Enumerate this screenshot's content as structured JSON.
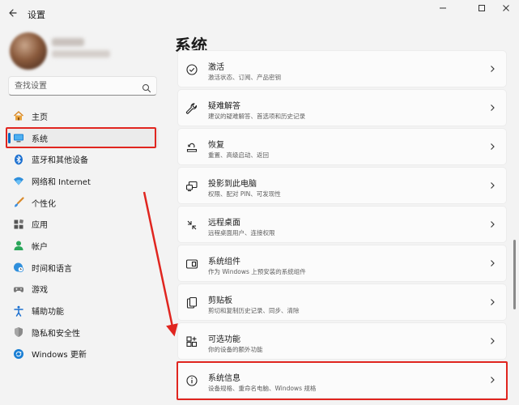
{
  "window": {
    "title": "设置",
    "back_icon": "back-arrow-icon",
    "controls": [
      "minimize-icon",
      "maximize-icon",
      "close-icon"
    ]
  },
  "profile": {
    "avatar": "blurred-avatar"
  },
  "search": {
    "placeholder": "查找设置",
    "icon": "search-icon"
  },
  "sidebar": {
    "items": [
      {
        "label": "主页",
        "icon": "home-icon",
        "selected": false
      },
      {
        "label": "系统",
        "icon": "display-icon",
        "selected": true
      },
      {
        "label": "蓝牙和其他设备",
        "icon": "bluetooth-icon",
        "selected": false
      },
      {
        "label": "网络和 Internet",
        "icon": "wifi-icon",
        "selected": false
      },
      {
        "label": "个性化",
        "icon": "brush-icon",
        "selected": false
      },
      {
        "label": "应用",
        "icon": "apps-icon",
        "selected": false
      },
      {
        "label": "帐户",
        "icon": "account-icon",
        "selected": false
      },
      {
        "label": "时间和语言",
        "icon": "globe-clock-icon",
        "selected": false
      },
      {
        "label": "游戏",
        "icon": "gamepad-icon",
        "selected": false
      },
      {
        "label": "辅助功能",
        "icon": "accessibility-icon",
        "selected": false
      },
      {
        "label": "隐私和安全性",
        "icon": "shield-icon",
        "selected": false
      },
      {
        "label": "Windows 更新",
        "icon": "update-icon",
        "selected": false
      }
    ]
  },
  "main": {
    "title": "系统",
    "cards": [
      {
        "title": "激活",
        "subtitle": "激活状态、订阅、产品密钥",
        "icon": "activation-check-icon"
      },
      {
        "title": "疑难解答",
        "subtitle": "建议的疑难解答、首选项和历史记录",
        "icon": "wrench-icon"
      },
      {
        "title": "恢复",
        "subtitle": "重置、高级启动、返回",
        "icon": "recovery-icon"
      },
      {
        "title": "投影到此电脑",
        "subtitle": "权限、配对 PIN、可发现性",
        "icon": "projection-icon"
      },
      {
        "title": "远程桌面",
        "subtitle": "远程桌面用户、连接权限",
        "icon": "remote-desktop-icon"
      },
      {
        "title": "系统组件",
        "subtitle": "作为 Windows 上预安装的系统组件",
        "icon": "system-components-icon"
      },
      {
        "title": "剪贴板",
        "subtitle": "剪切和复制历史记录、同步、清除",
        "icon": "clipboard-icon"
      },
      {
        "title": "可选功能",
        "subtitle": "你的设备的额外功能",
        "icon": "optional-features-icon"
      },
      {
        "title": "系统信息",
        "subtitle": "设备规格、重命名电脑、Windows 规格",
        "icon": "info-icon"
      }
    ]
  },
  "annotations": {
    "highlight_color": "#e0251f",
    "accent": "#0067c0"
  }
}
